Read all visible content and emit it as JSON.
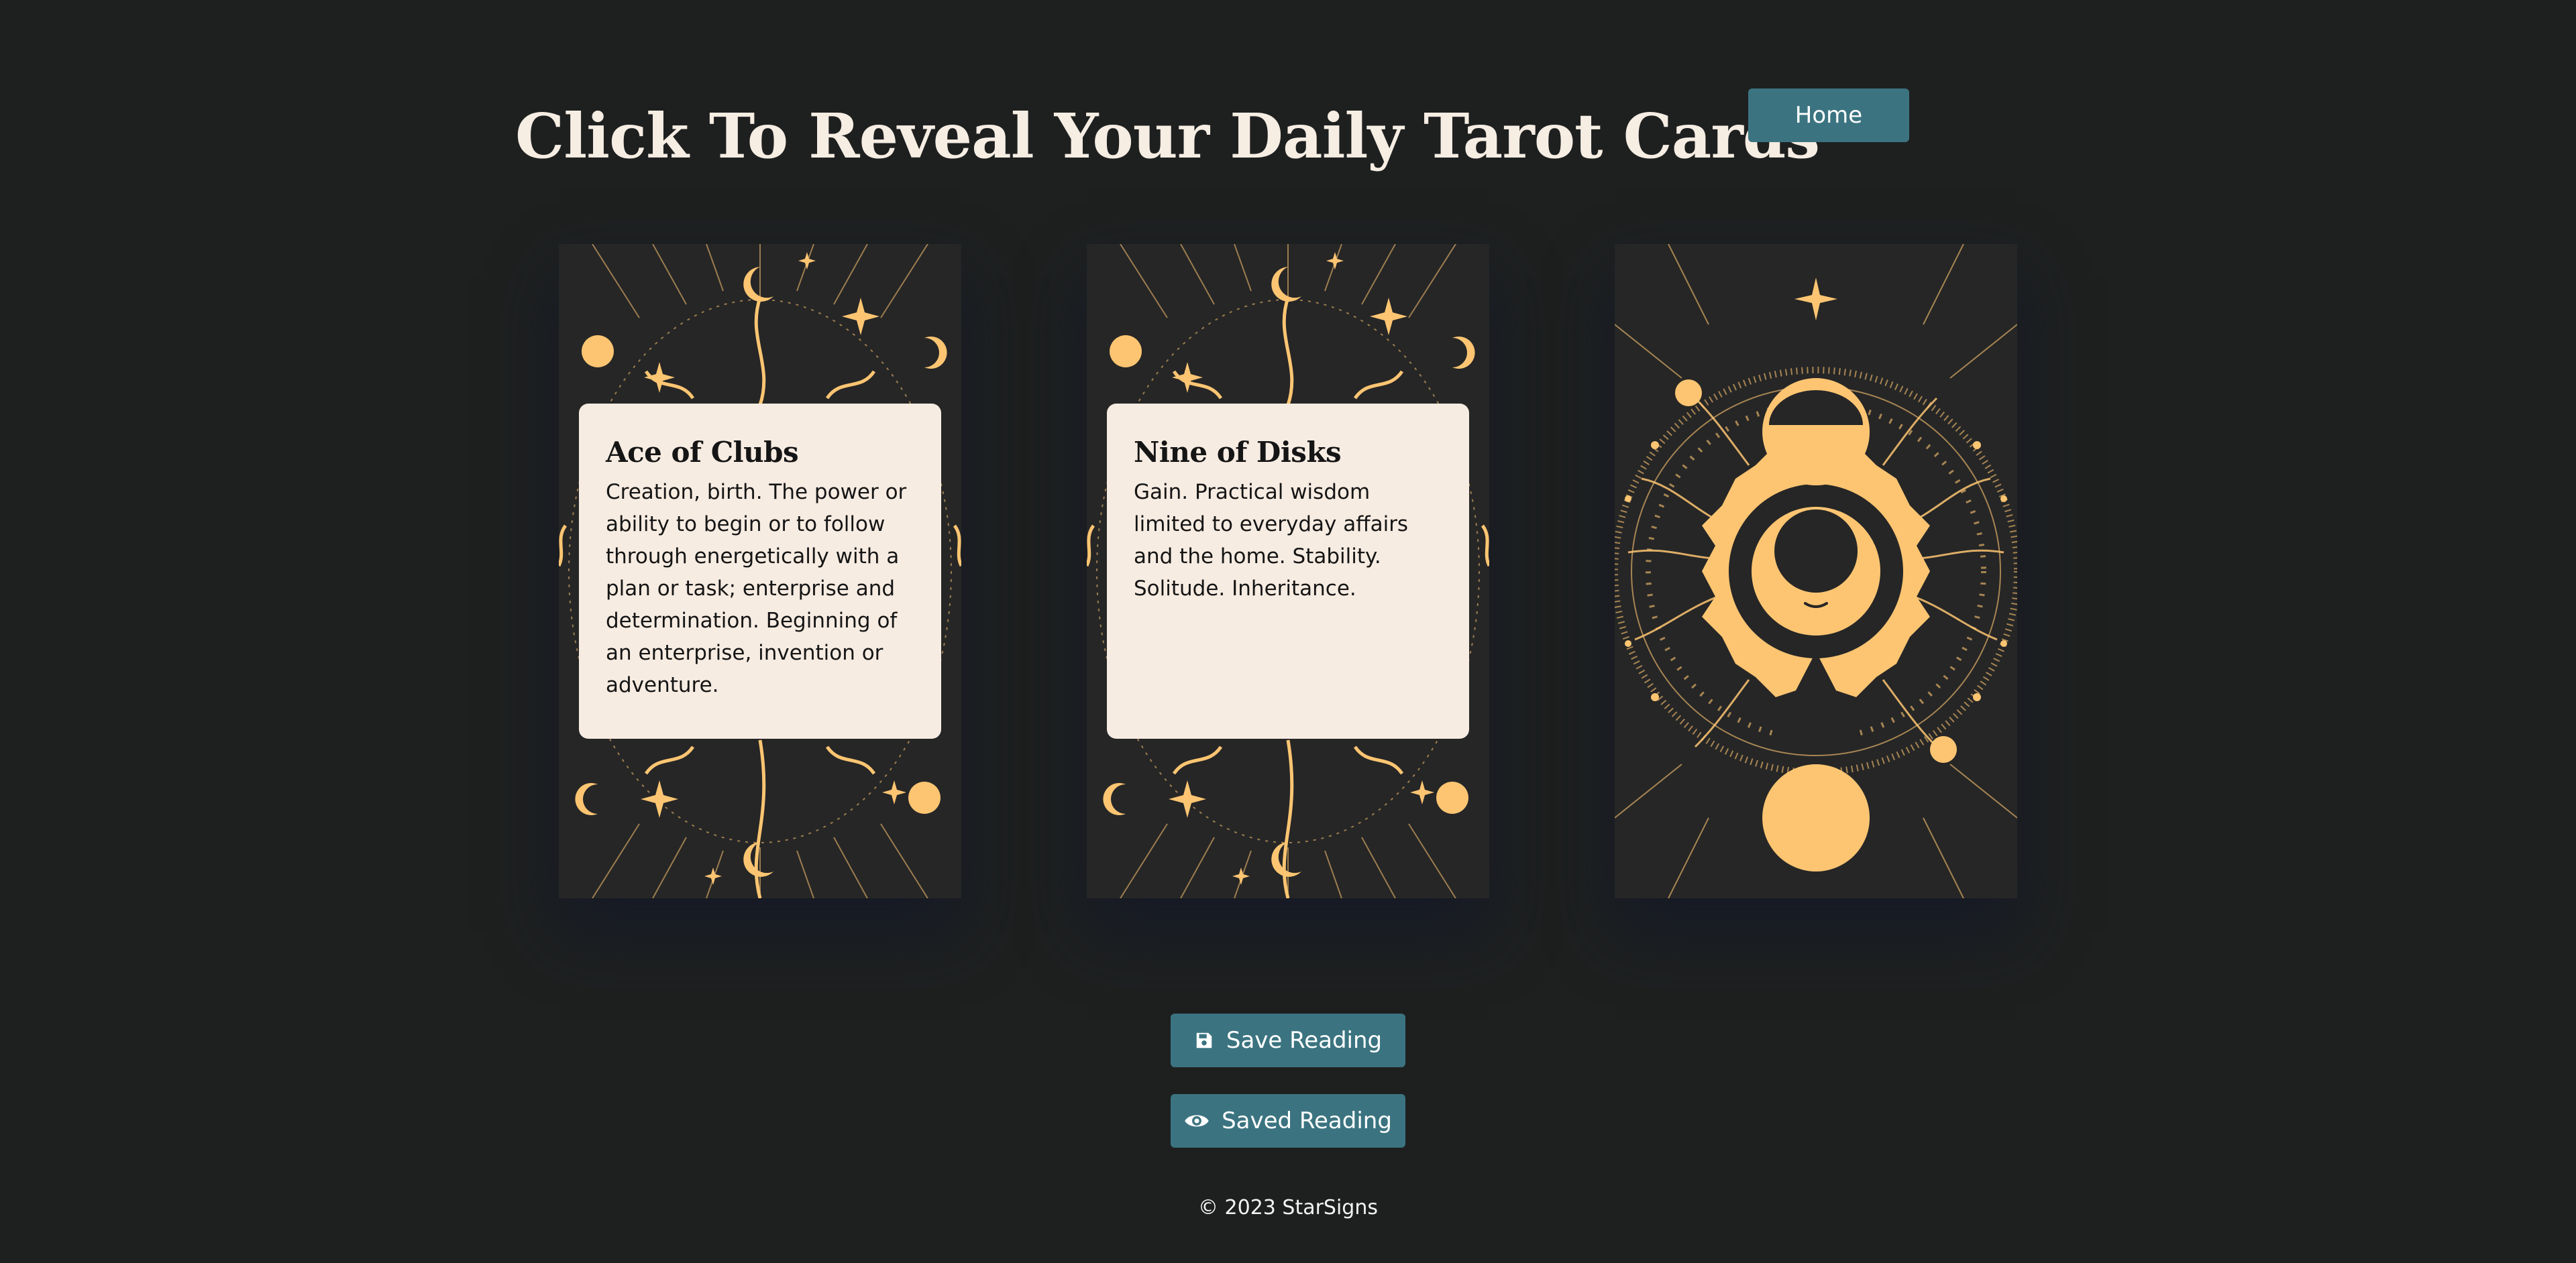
{
  "header": {
    "title": "Click To Reveal Your Daily Tarot Cards",
    "home_label": "Home"
  },
  "cards": [
    {
      "state": "revealed",
      "name": "Ace of Clubs",
      "meaning": "Creation, birth. The power or ability to begin or to follow through energetically with a plan or task; enterprise and determination. Beginning of an enterprise, invention or adventure."
    },
    {
      "state": "revealed",
      "name": "Nine of Disks",
      "meaning": "Gain. Practical wisdom limited to everyday affairs and the home. Stability. Solitude. Inheritance."
    },
    {
      "state": "face-down"
    }
  ],
  "actions": {
    "save_label": "Save Reading",
    "save_icon": "floppy-disk-icon",
    "saved_label": "Saved Reading",
    "saved_icon": "eye-icon"
  },
  "footer": {
    "copyright": "© 2023 StarSigns"
  },
  "colors": {
    "background": "#1e2020",
    "button": "#3b7480",
    "card_back": "#262626",
    "gold": "#fdc572",
    "panel": "#f7ece2",
    "title": "#f6ede3"
  }
}
